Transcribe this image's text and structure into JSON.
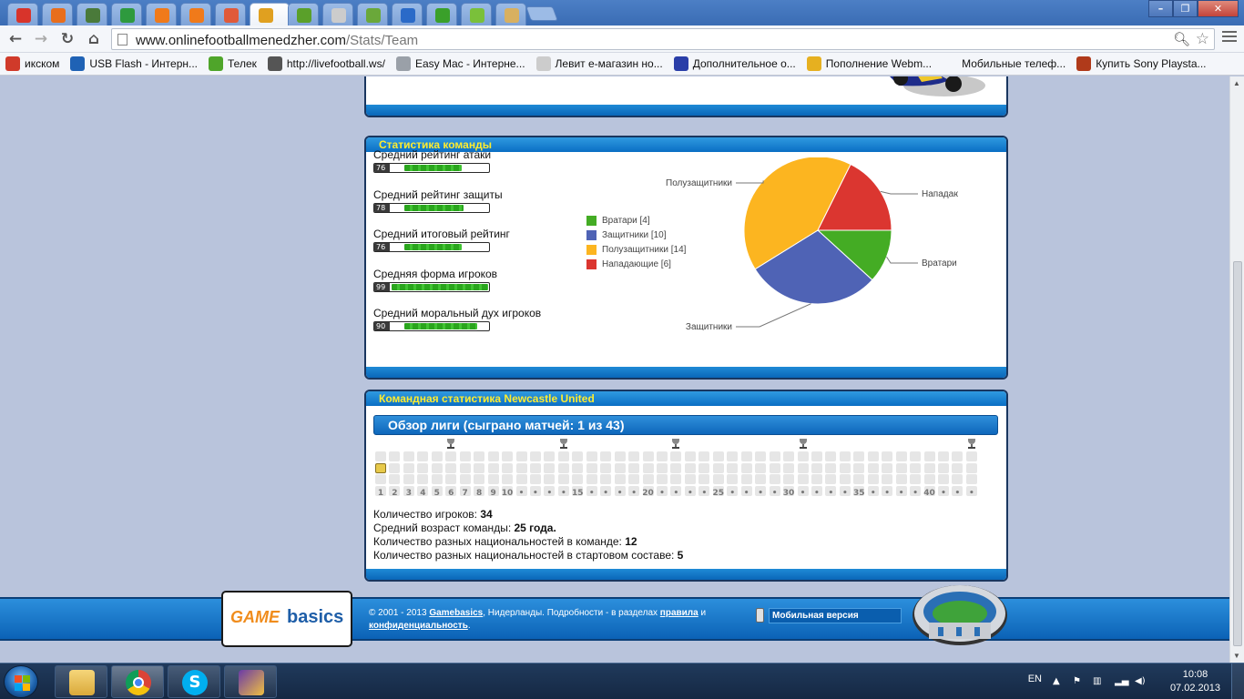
{
  "browser": {
    "url_host": "www.onlinefootballmenedzher.com",
    "url_path": "/Stats/Team",
    "tab_count": 16,
    "window_buttons": [
      "–",
      "❐",
      "✕"
    ]
  },
  "bookmarks": [
    {
      "label": "икском",
      "icon": "x-icon",
      "color": "#d03a2a"
    },
    {
      "label": "USB Flash - Интерн...",
      "icon": "globe-icon",
      "color": "#1f62b5"
    },
    {
      "label": "Телек",
      "icon": "frog-icon",
      "color": "#4fa52a"
    },
    {
      "label": "http://livefootball.ws/",
      "icon": "live-icon",
      "color": "#555555"
    },
    {
      "label": "Easy Mac - Интерне...",
      "icon": "apple-icon",
      "color": "#9aa0a8"
    },
    {
      "label": "Левит е-магазин но...",
      "icon": "page-icon",
      "color": "#cccccc"
    },
    {
      "label": "Дополнительное о...",
      "icon": "e-icon",
      "color": "#2a3ea8"
    },
    {
      "label": "Пополнение Webm...",
      "icon": "paw-icon",
      "color": "#e6b020"
    },
    {
      "label": "Мобильные телеф...",
      "icon": "blank-icon",
      "color": "#f4f6fa"
    },
    {
      "label": "Купить Sony Playsta...",
      "icon": "store-icon",
      "color": "#b03a1a"
    }
  ],
  "team_stats": {
    "title": "Статистика команды",
    "ratings": [
      {
        "label": "Средний рейтинг атаки",
        "value": "76",
        "fill": 0.76
      },
      {
        "label": "Средний рейтинг защиты",
        "value": "78",
        "fill": 0.78
      },
      {
        "label": "Средний итоговый рейтинг",
        "value": "76",
        "fill": 0.76
      },
      {
        "label": "Средняя форма игроков",
        "value": "99",
        "fill": 0.99
      },
      {
        "label": "Средний моральный дух игроков",
        "value": "90",
        "fill": 0.9
      }
    ]
  },
  "chart_data": {
    "type": "pie",
    "slices": [
      {
        "label": "Вратари",
        "value": 4,
        "color": "#44ac24",
        "legend": "Вратари [4]"
      },
      {
        "label": "Защитники",
        "value": 10,
        "color": "#4f63b5",
        "legend": "Защитники [10]"
      },
      {
        "label": "Полузащитники",
        "value": 14,
        "color": "#fcb520",
        "legend": "Полузащитники [14]"
      },
      {
        "label": "Нападающ",
        "value": 6,
        "color": "#db3630",
        "legend": "Нападающие [6]"
      }
    ],
    "legend_position": "left"
  },
  "league": {
    "section_title": "Командная статистика Newcastle United",
    "overview_title": "Обзор лиги (сыграно матчей: 1 из 43)",
    "rounds_total": 43,
    "rounds_played": 1,
    "round_labels": [
      "1",
      "2",
      "3",
      "4",
      "5",
      "6",
      "7",
      "8",
      "9",
      "10",
      "•",
      "•",
      "•",
      "•",
      "15",
      "•",
      "•",
      "•",
      "•",
      "20",
      "•",
      "•",
      "•",
      "•",
      "25",
      "•",
      "•",
      "•",
      "•",
      "30",
      "•",
      "•",
      "•",
      "•",
      "35",
      "•",
      "•",
      "•",
      "•",
      "40",
      "•",
      "•",
      "•"
    ],
    "cup_rounds": [
      6,
      14,
      22,
      31,
      43
    ]
  },
  "team_info": [
    {
      "label": "Количество игроков: ",
      "value": "34"
    },
    {
      "label": "Средний возраст команды: ",
      "value": "25 года."
    },
    {
      "label": "Количество разных национальностей в команде: ",
      "value": "12"
    },
    {
      "label": "Количество разных национальностей в стартовом составе: ",
      "value": "5"
    }
  ],
  "footer": {
    "logo_game": "GAME",
    "logo_basics": "basics",
    "copy_prefix": "© 2001 - 2013 ",
    "copy_brand": "Gamebasics",
    "copy_mid": ", Нидерланды. Подробности - в разделах ",
    "copy_rules": "правила",
    "copy_and": " и",
    "copy_privacy": "конфиденциальность",
    "copy_end": ".",
    "mobile_label": "Мобильная версия"
  },
  "taskbar": {
    "lang": "EN",
    "time": "10:08",
    "date": "07.02.2013"
  },
  "colors": {
    "accent_blue": "#0a6ec4",
    "header_text": "#ffec2f",
    "bar_green": "#2aa51d"
  }
}
